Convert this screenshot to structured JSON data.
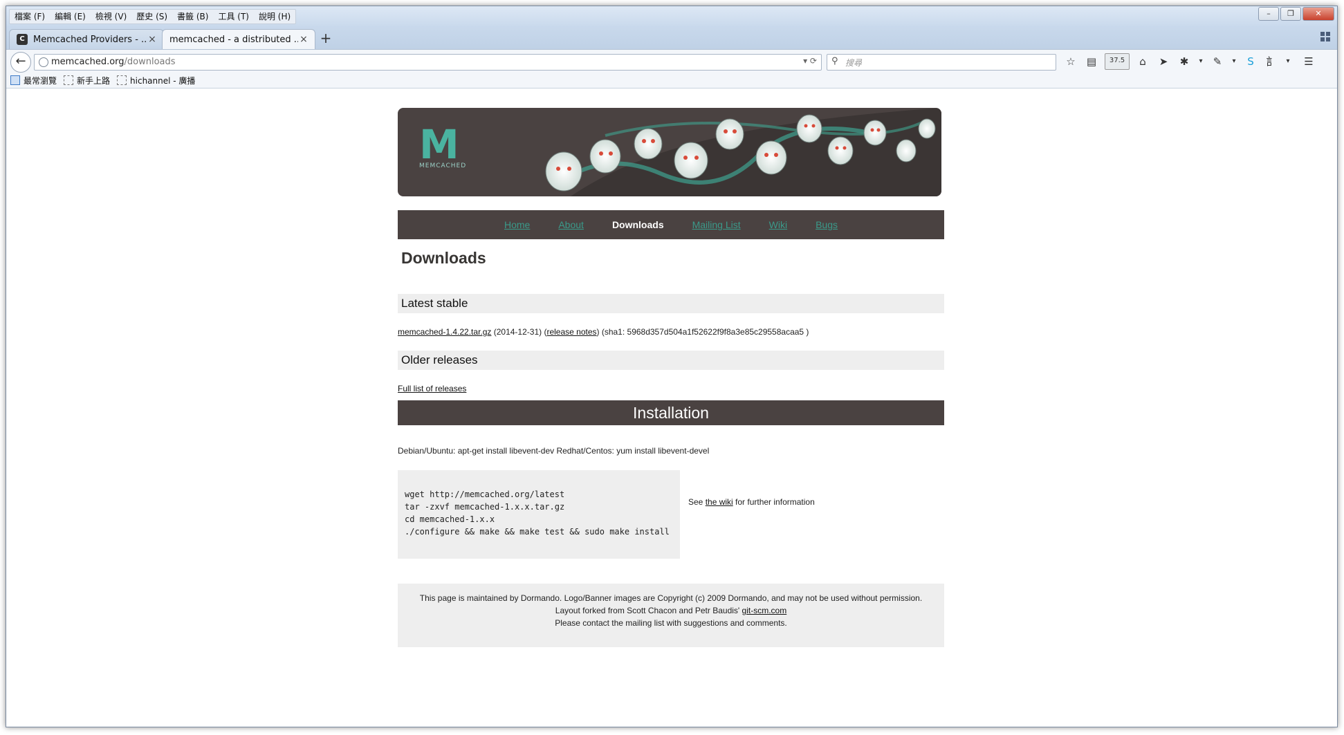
{
  "browser": {
    "menu": [
      "檔案 (F)",
      "編輯 (E)",
      "檢視 (V)",
      "歷史 (S)",
      "書籤 (B)",
      "工具 (T)",
      "說明 (H)"
    ],
    "tabs": [
      {
        "title": "Memcached Providers - ...",
        "close": "×"
      },
      {
        "title": "memcached - a distributed ...",
        "close": "×"
      }
    ],
    "new_tab": "+",
    "url_host": "memcached.org",
    "url_path": "/downloads",
    "search_placeholder": "搜尋",
    "weather": "37.5",
    "bookmarks": [
      "最常瀏覽",
      "新手上路",
      "hichannel - 廣播"
    ]
  },
  "page": {
    "logo_letter": "M",
    "logo_text": "MEMCACHED",
    "nav": [
      "Home",
      "About",
      "Downloads",
      "Mailing List",
      "Wiki",
      "Bugs"
    ],
    "title": "Downloads",
    "latest_stable_heading": "Latest stable",
    "latest_file": "memcached-1.4.22.tar.gz",
    "latest_date": " (2014-12-31) (",
    "release_notes": "release notes",
    "sha1": ") (sha1: 5968d357d504a1f52622f9f8a3e85c29558acaa5 )",
    "older_heading": "Older releases",
    "full_list": "Full list of releases",
    "install_heading": "Installation",
    "deps": "Debian/Ubuntu: apt-get install libevent-dev Redhat/Centos: yum install libevent-devel",
    "code": "wget http://memcached.org/latest\ntar -zxvf memcached-1.x.x.tar.gz\ncd memcached-1.x.x\n./configure && make && make test && sudo make install",
    "see": "See ",
    "the_wiki": "the wiki",
    "further": " for further information",
    "footer_line1": "This page is maintained by Dormando. Logo/Banner images are Copyright (c) 2009 Dormando, and may not be used without permission.",
    "footer_line2": "Layout forked from Scott Chacon and Petr Baudis' ",
    "footer_link": "git-scm.com",
    "footer_line3": "Please contact the mailing list with suggestions and comments."
  }
}
